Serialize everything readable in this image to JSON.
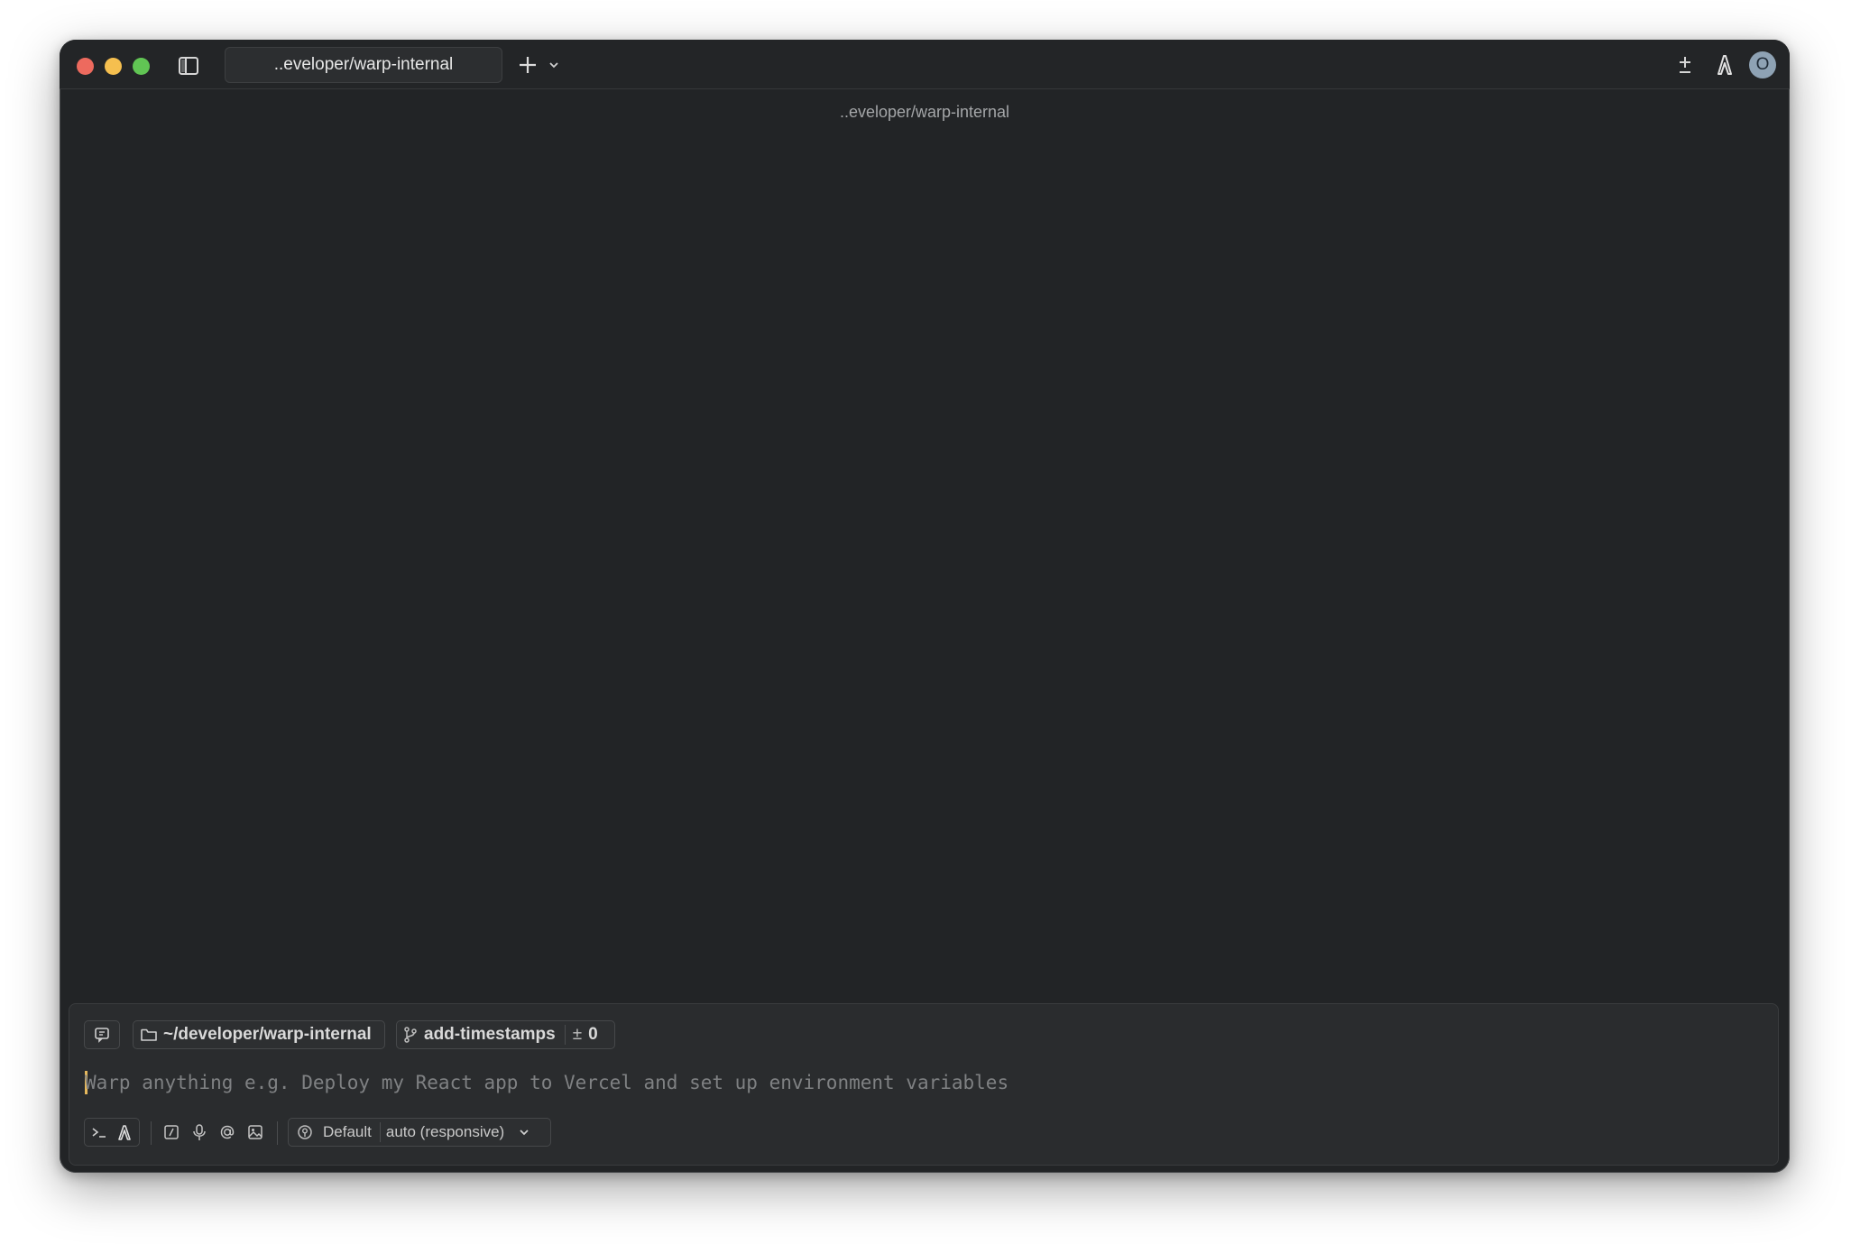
{
  "window": {
    "tab_title": "..eveloper/warp-internal",
    "pane_title": "..eveloper/warp-internal",
    "avatar_initial": "O"
  },
  "context_chips": {
    "directory": "~/developer/warp-internal",
    "branch": "add-timestamps",
    "diff_symbol": "±",
    "diff_count": "0"
  },
  "input": {
    "placeholder": "Warp anything e.g. Deploy my React app to Vercel and set up environment variables"
  },
  "toolbar": {
    "profile": "Default",
    "model": "auto (responsive)"
  },
  "icons": [
    "sidebar-toggle-icon",
    "plus-icon",
    "chevron-down-icon",
    "plus-minus-icon",
    "warp-agent-icon",
    "chat-icon",
    "folder-icon",
    "git-branch-icon",
    "terminal-icon",
    "slash-command-icon",
    "microphone-icon",
    "at-sign-icon",
    "image-icon",
    "profile-icon"
  ],
  "colors": {
    "background": "#222426",
    "panel": "#2a2c2e",
    "cursor": "#e6b85c",
    "close": "#ed6a5e",
    "minimize": "#f5bf4f",
    "maximize": "#61c554"
  }
}
